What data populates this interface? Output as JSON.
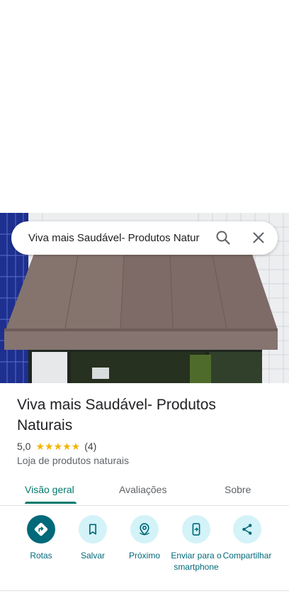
{
  "search": {
    "query": "Viva mais Saudável- Produtos Natur"
  },
  "place": {
    "title": "Viva mais Saudável- Produtos Naturais",
    "rating": "5,0",
    "stars": "★★★★★",
    "review_count": "(4)",
    "category": "Loja de produtos naturais"
  },
  "tabs": [
    {
      "label": "Visão geral",
      "active": true
    },
    {
      "label": "Avaliações",
      "active": false
    },
    {
      "label": "Sobre",
      "active": false
    }
  ],
  "actions": [
    {
      "label": "Rotas",
      "icon": "directions-icon"
    },
    {
      "label": "Salvar",
      "icon": "bookmark-icon"
    },
    {
      "label": "Próximo",
      "icon": "nearby-icon"
    },
    {
      "label": "Enviar para o smartphone",
      "icon": "send-to-phone-icon"
    },
    {
      "label": "Compartilhar",
      "icon": "share-icon"
    }
  ],
  "colors": {
    "accent": "#00796b",
    "action_bg": "#d3f3f8",
    "primary_action": "#00697a",
    "star": "#f4b400"
  }
}
